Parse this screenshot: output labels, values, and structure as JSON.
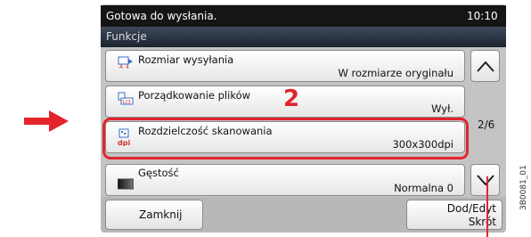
{
  "status": {
    "message": "Gotowa do wysłania.",
    "time": "10:10"
  },
  "header": {
    "title": "Funkcje"
  },
  "list": {
    "items": [
      {
        "title": "Rozmiar wysyłania",
        "value": "W  rozmiarze oryginału",
        "icon": "send-size-icon"
      },
      {
        "title": "Porządkowanie plików",
        "value": "Wył.",
        "icon": "file-separation-icon"
      },
      {
        "title": "Rozdzielczość skanowania",
        "value": "300x300dpi",
        "icon": "dpi-icon"
      },
      {
        "title": "Gęstość",
        "value": "Normalna 0",
        "icon": "density-icon"
      }
    ],
    "page": "2/6"
  },
  "callout": {
    "step": "2"
  },
  "buttons": {
    "close": "Zamknij",
    "add_edit_line1": "Dod/Edyt",
    "add_edit_line2": "Skrót"
  },
  "figure_id": "3B0081_01",
  "colors": {
    "callout": "#e3242b",
    "status_bar": "#151515"
  }
}
